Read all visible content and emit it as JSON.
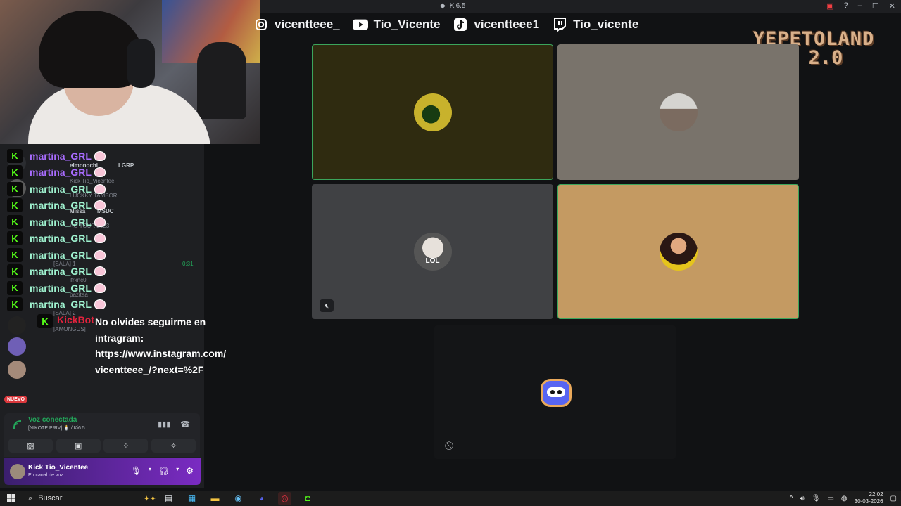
{
  "window": {
    "title": "Ki6.5",
    "controls": [
      "minimize",
      "maximize",
      "close"
    ]
  },
  "socials": [
    {
      "icon": "instagram-icon",
      "handle": "vicentteee_"
    },
    {
      "icon": "youtube-icon",
      "handle": "Tio_Vicente"
    },
    {
      "icon": "tiktok-icon",
      "handle": "vicentteee1"
    },
    {
      "icon": "twitch-icon",
      "handle": "Tio_vicente"
    }
  ],
  "brand": {
    "line1": "YEPETOLAND",
    "line2": "2.0"
  },
  "chat": {
    "repeat_user": "martina_GRL",
    "repeat_color": "#b58cff",
    "repeat_color_alt": "#9ff2cf",
    "rows": [
      {
        "name": "martina_GRL",
        "color": "#a96cff"
      },
      {
        "name": "martina_GRL",
        "color": "#a96cff"
      },
      {
        "name": "martina_GRL",
        "color": "#9ff2cf"
      },
      {
        "name": "martina_GRL",
        "color": "#9ff2cf"
      },
      {
        "name": "martina_GRL",
        "color": "#9ff2cf"
      },
      {
        "name": "martina_GRL",
        "color": "#9ff2cf"
      },
      {
        "name": "martina_GRL",
        "color": "#9ff2cf"
      },
      {
        "name": "martina_GRL",
        "color": "#9ff2cf"
      },
      {
        "name": "martina_GRL",
        "color": "#9ff2cf"
      },
      {
        "name": "martina_GRL",
        "color": "#9ff2cf"
      }
    ],
    "bot": {
      "name": "KickBot",
      "lines": [
        "No olvides seguirme en",
        "intragram:",
        "https://www.instagram.com/",
        "vicentteee_/?next=%2F"
      ]
    }
  },
  "background_channel": {
    "items": [
      "elmonochi",
      "LGRP",
      "Kick Tio_Vicentee",
      "LUCKKY TAMBOR",
      "Missa",
      "MSDC",
      "AO TOUR 2023",
      "[SALA] 1",
      "ifrxnc0",
      "pazitaa",
      "[SALA] 2",
      "[AMONGUS]"
    ],
    "timer": "0:31",
    "new_badge": "NUEVO"
  },
  "voice_panel": {
    "status": "Voz conectada",
    "channel": "[NIKOTE PRIV] 🕯️ / Ki6.5"
  },
  "user": {
    "name": "Kick Tio_Vicentee",
    "status": "En canal de voz"
  },
  "tiles": [
    {
      "label": "participant-1",
      "speaking": true
    },
    {
      "label": "participant-2",
      "speaking": false
    },
    {
      "label": "participant-3",
      "badge": "LOL",
      "speaking": false
    },
    {
      "label": "participant-4",
      "speaking": true
    }
  ],
  "taskbar": {
    "search_placeholder": "Buscar",
    "time": "22:02",
    "date": "30-03-2026"
  }
}
